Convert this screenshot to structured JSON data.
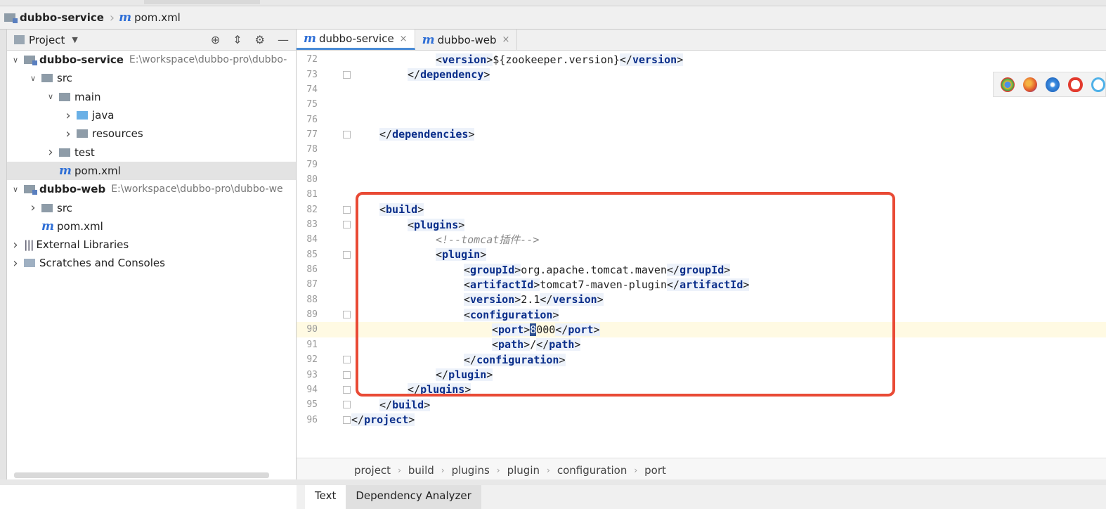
{
  "breadcrumb": {
    "project": "dubbo-service",
    "file": "pom.xml"
  },
  "project_panel": {
    "title": "Project",
    "tree": [
      {
        "label": "dubbo-service",
        "path": "E:\\workspace\\dubbo-pro\\dubbo-",
        "bold": true,
        "arrow": "down",
        "indent": 0,
        "icon": "module-folder-icon"
      },
      {
        "label": "src",
        "arrow": "down",
        "indent": 1,
        "icon": "folder-icon"
      },
      {
        "label": "main",
        "arrow": "down",
        "indent": 2,
        "icon": "folder-icon"
      },
      {
        "label": "java",
        "arrow": "right",
        "indent": 3,
        "icon": "source-folder-icon"
      },
      {
        "label": "resources",
        "arrow": "right",
        "indent": 3,
        "icon": "resources-folder-icon"
      },
      {
        "label": "test",
        "arrow": "right",
        "indent": 2,
        "icon": "folder-icon"
      },
      {
        "label": "pom.xml",
        "arrow": "",
        "indent": 2,
        "icon": "maven-icon",
        "selected": true
      },
      {
        "label": "dubbo-web",
        "path": "E:\\workspace\\dubbo-pro\\dubbo-we",
        "bold": true,
        "arrow": "down",
        "indent": 0,
        "icon": "module-folder-icon"
      },
      {
        "label": "src",
        "arrow": "right",
        "indent": 1,
        "icon": "folder-icon"
      },
      {
        "label": "pom.xml",
        "arrow": "",
        "indent": 1,
        "icon": "maven-icon"
      },
      {
        "label": "External Libraries",
        "arrow": "right",
        "indent": 0,
        "icon": "library-icon"
      },
      {
        "label": "Scratches and Consoles",
        "arrow": "right",
        "indent": 0,
        "icon": "scratches-icon"
      }
    ]
  },
  "editor": {
    "tabs": [
      {
        "label": "dubbo-service",
        "active": true,
        "close": "×"
      },
      {
        "label": "dubbo-web",
        "active": false,
        "close": "×"
      }
    ],
    "lines": [
      {
        "n": "72",
        "indent": 3,
        "html": "ver",
        "open": "version",
        "text": "${zookeeper.version}",
        "close": "version"
      },
      {
        "n": "73",
        "indent": 2,
        "closeOnly": "dependency"
      },
      {
        "n": "74"
      },
      {
        "n": "75"
      },
      {
        "n": "76"
      },
      {
        "n": "77",
        "indent": 1,
        "closeOnly": "dependencies"
      },
      {
        "n": "78"
      },
      {
        "n": "79"
      },
      {
        "n": "80"
      },
      {
        "n": "81"
      },
      {
        "n": "82",
        "indent": 1,
        "openOnly": "build"
      },
      {
        "n": "83",
        "indent": 2,
        "openOnly": "plugins"
      },
      {
        "n": "84",
        "indent": 3,
        "comment": "<!--tomcat插件-->"
      },
      {
        "n": "85",
        "indent": 3,
        "openOnly": "plugin"
      },
      {
        "n": "86",
        "indent": 4,
        "open": "groupId",
        "text": "org.apache.tomcat.maven",
        "close": "groupId"
      },
      {
        "n": "87",
        "indent": 4,
        "open": "artifactId",
        "text": "tomcat7-maven-plugin",
        "close": "artifactId"
      },
      {
        "n": "88",
        "indent": 4,
        "open": "version",
        "text": "2.1",
        "close": "version"
      },
      {
        "n": "89",
        "indent": 4,
        "openOnly": "configuration"
      },
      {
        "n": "90",
        "indent": 5,
        "open": "port",
        "text": "8000",
        "close": "port",
        "current": true
      },
      {
        "n": "91",
        "indent": 5,
        "open": "path",
        "text": "/",
        "close": "path"
      },
      {
        "n": "92",
        "indent": 4,
        "closeOnly": "configuration"
      },
      {
        "n": "93",
        "indent": 3,
        "closeOnly": "plugin"
      },
      {
        "n": "94",
        "indent": 2,
        "closeOnly": "plugins"
      },
      {
        "n": "95",
        "indent": 1,
        "closeOnly": "build"
      },
      {
        "n": "96",
        "indent": 0,
        "closeOnly": "project"
      }
    ],
    "breadcrumb": [
      "project",
      "build",
      "plugins",
      "plugin",
      "configuration",
      "port"
    ],
    "bottom_tabs": [
      {
        "label": "Text",
        "active": true
      },
      {
        "label": "Dependency Analyzer",
        "active": false
      }
    ]
  },
  "colors": {
    "highlight_box": "#e94a35",
    "tag": "#0a2e8a",
    "maven": "#2f6fd6"
  },
  "browser_icons": [
    "chrome-icon",
    "firefox-icon",
    "safari-icon",
    "opera-icon",
    "ie-icon"
  ]
}
